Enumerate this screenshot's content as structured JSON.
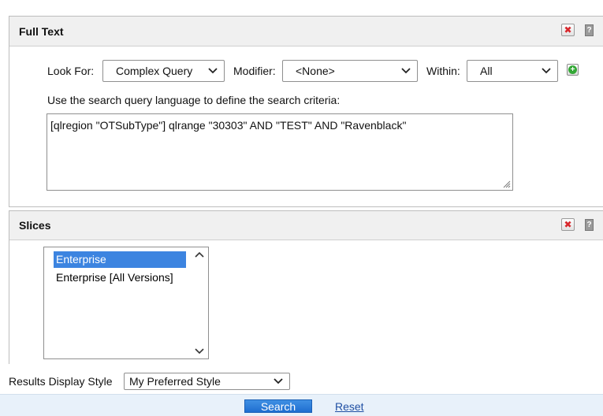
{
  "full_text_panel": {
    "title": "Full Text",
    "close_glyph": "✖",
    "help_glyph": "?",
    "look_for_label": "Look For:",
    "look_for_value": "Complex Query",
    "modifier_label": "Modifier:",
    "modifier_value": "<None>",
    "within_label": "Within:",
    "within_value": "All",
    "add_glyph": "+",
    "instruction": "Use the search query language to define the search criteria:",
    "query": "[qlregion \"OTSubType\"] qlrange \"30303\" AND \"TEST\" AND \"Ravenblack\""
  },
  "slices_panel": {
    "title": "Slices",
    "close_glyph": "✖",
    "help_glyph": "?",
    "items": [
      {
        "label": "Enterprise",
        "selected": true
      },
      {
        "label": "Enterprise [All Versions]",
        "selected": false
      }
    ]
  },
  "results": {
    "label": "Results Display Style",
    "value": "My Preferred Style"
  },
  "actions": {
    "search_label": "Search",
    "reset_label": "Reset"
  },
  "colors": {
    "accent": "#2e7fdb",
    "close_icon": "#d8262b",
    "add_icon": "#34a836",
    "selected_item": "#3c84e0",
    "link": "#1f4fa3"
  }
}
